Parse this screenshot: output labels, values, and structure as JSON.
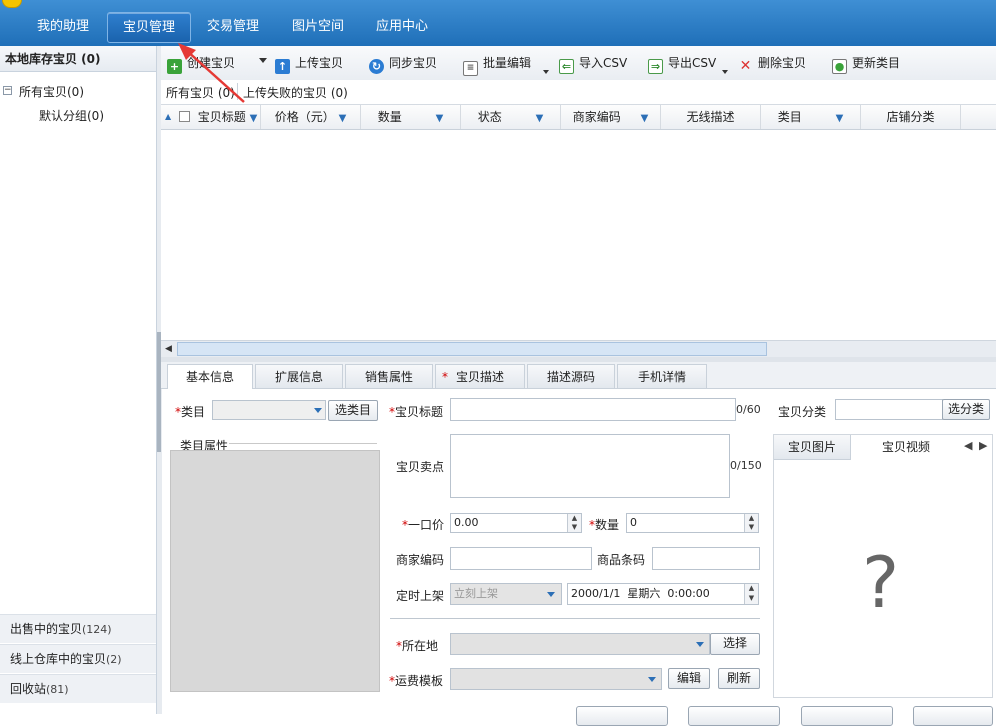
{
  "nav": {
    "tabs": [
      {
        "label": "我的助理"
      },
      {
        "label": "宝贝管理"
      },
      {
        "label": "交易管理"
      },
      {
        "label": "图片空间"
      },
      {
        "label": "应用中心"
      }
    ],
    "active_tab": "宝贝管理"
  },
  "sidebar": {
    "header": "本地库存宝贝 (0)",
    "tree": [
      {
        "label": "所有宝贝(0)",
        "toggle": "−"
      },
      {
        "label": "默认分组(0)"
      }
    ],
    "bottom": [
      {
        "label": "出售中的宝贝",
        "count": "(124)"
      },
      {
        "label": "线上仓库中的宝贝",
        "count": "(2)"
      },
      {
        "label": "回收站",
        "count": "(81)"
      }
    ]
  },
  "toolbar": {
    "create": "创建宝贝",
    "upload": "上传宝贝",
    "sync": "同步宝贝",
    "batch_edit": "批量编辑",
    "import_csv": "导入CSV",
    "export_csv": "导出CSV",
    "delete": "删除宝贝",
    "update_category": "更新类目"
  },
  "subtabs": [
    "所有宝贝 (0)",
    "上传失败的宝贝 (0)"
  ],
  "grid": {
    "columns": [
      "宝贝标题",
      "价格（元）",
      "数量",
      "状态",
      "商家编码",
      "无线描述",
      "类目",
      "店铺分类"
    ]
  },
  "detail_tabs": [
    "基本信息",
    "扩展信息",
    "销售属性",
    "宝贝描述",
    "描述源码",
    "手机详情"
  ],
  "form": {
    "category_label": "类目",
    "category_button": "选类目",
    "category_props": "类目属性",
    "title_label": "宝贝标题",
    "title_counter": "0/60",
    "shop_category_label": "宝贝分类",
    "shop_category_button": "选分类",
    "selling_point_label": "宝贝卖点",
    "selling_point_counter": "0/150",
    "price_label": "一口价",
    "price_value": "0.00",
    "quantity_label": "数量",
    "quantity_value": "0",
    "merchant_code_label": "商家编码",
    "barcode_label": "商品条码",
    "schedule_label": "定时上架",
    "schedule_option": "立刻上架",
    "schedule_datetime": "2000/1/1  星期六  0:00:00",
    "location_label": "所在地",
    "location_button": "选择",
    "shipping_label": "运费模板",
    "shipping_edit": "编辑",
    "shipping_refresh": "刷新"
  },
  "media": {
    "tabs": [
      "宝贝图片",
      "宝贝视频"
    ],
    "placeholder": "?"
  },
  "colors": {
    "nav_bg": "#1f6fb8",
    "required": "#d00000",
    "annotation_arrow": "#e53935"
  }
}
